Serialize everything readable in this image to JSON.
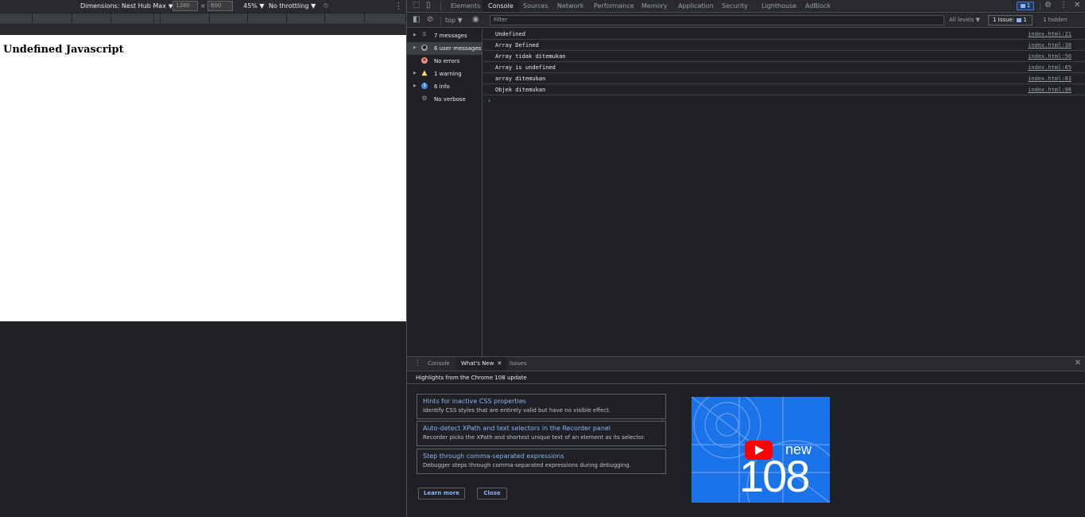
{
  "device_toolbar": {
    "dimensions_label": "Dimensions: Nest Hub Max",
    "width": "1280",
    "height": "800",
    "times": "×",
    "zoom": "45%",
    "throttling": "No throttling"
  },
  "page": {
    "heading": "Undefined Javascript"
  },
  "devtools": {
    "tabs": [
      "Elements",
      "Console",
      "Sources",
      "Network",
      "Performance",
      "Memory",
      "Application",
      "Security",
      "Lighthouse",
      "AdBlock"
    ],
    "active_tab": "Console",
    "issue_badge_count": "1"
  },
  "console_toolbar": {
    "context": "top",
    "filter_placeholder": "Filter",
    "levels": "All levels",
    "issues_label": "1 Issue:",
    "issues_count": "1",
    "hidden": "1 hidden"
  },
  "sidebar": {
    "items": [
      {
        "label": "7 messages",
        "icon": "list-icon"
      },
      {
        "label": "6 user messages",
        "icon": "user-icon"
      },
      {
        "label": "No errors",
        "icon": "error-icon"
      },
      {
        "label": "1 warning",
        "icon": "warning-icon"
      },
      {
        "label": "6 info",
        "icon": "info-icon"
      },
      {
        "label": "No verbose",
        "icon": "verbose-icon"
      }
    ]
  },
  "messages": [
    {
      "text": "Undefined",
      "source": "index.html:21"
    },
    {
      "text": "Array Defined",
      "source": "index.html:38"
    },
    {
      "text": "Array tidak ditemukan",
      "source": "index.html:50"
    },
    {
      "text": "Array is undefined",
      "source": "index.html:65"
    },
    {
      "text": "array ditemukan",
      "source": "index.html:83"
    },
    {
      "text": "Objek ditemukan",
      "source": "index.html:96"
    }
  ],
  "drawer": {
    "tabs": [
      "Console",
      "What's New",
      "Issues"
    ],
    "active_tab": "What's New",
    "heading": "Highlights from the Chrome 108 update",
    "cards": [
      {
        "title": "Hints for inactive CSS properties",
        "desc": "Identify CSS styles that are entirely valid but have no visible effect."
      },
      {
        "title": "Auto-detect XPath and text selectors in the Recorder panel",
        "desc": "Recorder picks the XPath and shortest unique text of an element as its selector."
      },
      {
        "title": "Step through comma-separated expressions",
        "desc": "Debugger steps through comma-separated expressions during debugging."
      }
    ],
    "learn_more": "Learn more",
    "close": "Close",
    "promo_new": "new",
    "promo_version": "108"
  },
  "colors": {
    "panel_bg": "#202124",
    "toolbar_bg": "#292a2d",
    "link": "#8ab4f8",
    "error": "#f28b82",
    "warning": "#fdd663",
    "info": "#4285f4",
    "promo_bg": "#1a73e8",
    "youtube_red": "#ff0000"
  }
}
